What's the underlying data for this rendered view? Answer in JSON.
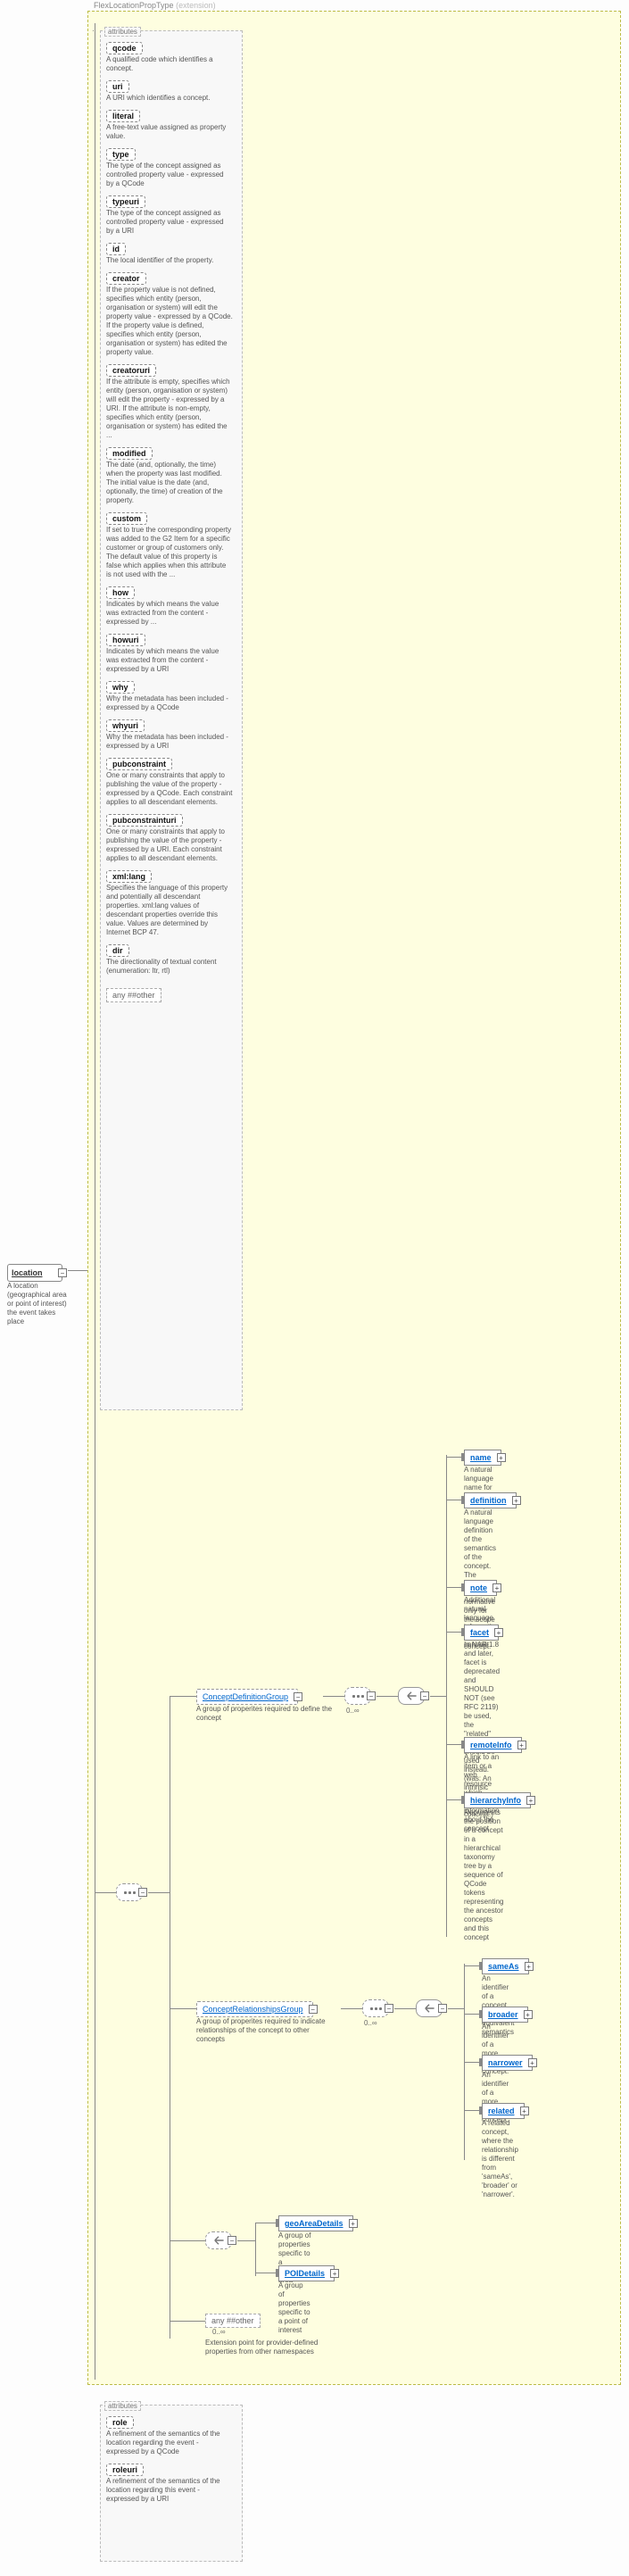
{
  "ext": {
    "title": "FlexLocationPropType",
    "suffix": "(extension)"
  },
  "root": {
    "label": "location",
    "desc": "A location (geographical area or point of interest) the event takes place",
    "expand": "−"
  },
  "attrBlock1": {
    "header": "attributes",
    "items": [
      {
        "name": "qcode",
        "desc": "A qualified code which identifies a concept."
      },
      {
        "name": "uri",
        "desc": "A URI which identifies a concept."
      },
      {
        "name": "literal",
        "desc": "A free-text value assigned as property value."
      },
      {
        "name": "type",
        "desc": "The type of the concept assigned as controlled property value - expressed by a QCode"
      },
      {
        "name": "typeuri",
        "desc": "The type of the concept assigned as controlled property value - expressed by a URI"
      },
      {
        "name": "id",
        "desc": "The local identifier of the property."
      },
      {
        "name": "creator",
        "desc": "If the property value is not defined, specifies which entity (person, organisation or system) will edit the property value - expressed by a QCode. If the property value is defined, specifies which entity (person, organisation or system) has edited the property value."
      },
      {
        "name": "creatoruri",
        "desc": "If the attribute is empty, specifies which entity (person, organisation or system) will edit the property - expressed by a URI. If the attribute is non-empty, specifies which entity (person, organisation or system) has edited the ..."
      },
      {
        "name": "modified",
        "desc": "The date (and, optionally, the time) when the property was last modified. The initial value is the date (and, optionally, the time) of creation of the property."
      },
      {
        "name": "custom",
        "desc": "If set to true the corresponding property was added to the G2 Item for a specific customer or group of customers only. The default value of this property is false which applies when this attribute is not used with the ..."
      },
      {
        "name": "how",
        "desc": "Indicates by which means the value was extracted from the content - expressed by ..."
      },
      {
        "name": "howuri",
        "desc": "Indicates by which means the value was extracted from the content - expressed by a URI"
      },
      {
        "name": "why",
        "desc": "Why the metadata has been included - expressed by a QCode"
      },
      {
        "name": "whyuri",
        "desc": "Why the metadata has been included - expressed by a URI"
      },
      {
        "name": "pubconstraint",
        "desc": "One or many constraints that apply to publishing the value of the property - expressed by a QCode. Each constraint applies to all descendant elements."
      },
      {
        "name": "pubconstrainturi",
        "desc": "One or many constraints that apply to publishing the value of the property - expressed by a URI. Each constraint applies to all descendant elements."
      },
      {
        "name": "xml:lang",
        "desc": "Specifies the language of this property and potentially all descendant properties. xml:lang values of descendant properties override this value. Values are determined by Internet BCP 47."
      },
      {
        "name": "dir",
        "desc": "The directionality of textual content (enumeration: ltr, rtl)"
      }
    ],
    "any": "any ##other"
  },
  "attrBlock2": {
    "header": "attributes",
    "items": [
      {
        "name": "role",
        "desc": "A refinement of the semantics of the location regarding the event - expressed by a QCode"
      },
      {
        "name": "roleuri",
        "desc": "A refinement of the semantics of the location regarding this event - expressed by a URI"
      }
    ]
  },
  "comp": {
    "expand": "−",
    "collapse": "+"
  },
  "grpDef": {
    "label": "ConceptDefinitionGroup",
    "desc": "A group of properites required to define the concept",
    "occur": "0..∞"
  },
  "grpRel": {
    "label": "ConceptRelationshipsGroup",
    "desc": "A group of properites required to indicate relationships of the concept to other concepts",
    "occur": "0..∞"
  },
  "defChildren": [
    {
      "name": "name",
      "desc": "A natural language name for the concept."
    },
    {
      "name": "definition",
      "desc": "A natural language definition of the semantics of the concept. The definition is normative only for the scope of the use of this concept."
    },
    {
      "name": "note",
      "desc": "Additional natural language information about the concept."
    },
    {
      "name": "facet",
      "desc": "In NAR 1.8 and later, facet is deprecated and SHOULD NOT (see RFC 2119) be used, the \"related\" property should be used instead. (was: An intrinsic property of the concept.)"
    },
    {
      "name": "remoteInfo",
      "desc": "A link to an item or a web resource which provides information about the concept"
    },
    {
      "name": "hierarchyInfo",
      "desc": "Represents the position of a concept in a hierarchical taxonomy tree by a sequence of QCode tokens representing the ancestor concepts and this concept"
    }
  ],
  "relChildren": [
    {
      "name": "sameAs",
      "desc": "An identifier of a concept with equivalent semantics"
    },
    {
      "name": "broader",
      "desc": "An identifier of a more generic concept."
    },
    {
      "name": "narrower",
      "desc": "An identifier of a more specific concept."
    },
    {
      "name": "related",
      "desc": "A related concept, where the relationship is different from 'sameAs', 'broader' or 'narrower'."
    }
  ],
  "geoChildren": [
    {
      "name": "geoAreaDetails",
      "desc": "A group of properties specific to a geopolitical area"
    },
    {
      "name": "POIDetails",
      "desc": "A group of properties specific to a point of interest"
    }
  ],
  "extAny": {
    "label": "any ##other",
    "occur": "0..∞",
    "desc": "Extension point for provider-defined properties from other namespaces"
  }
}
